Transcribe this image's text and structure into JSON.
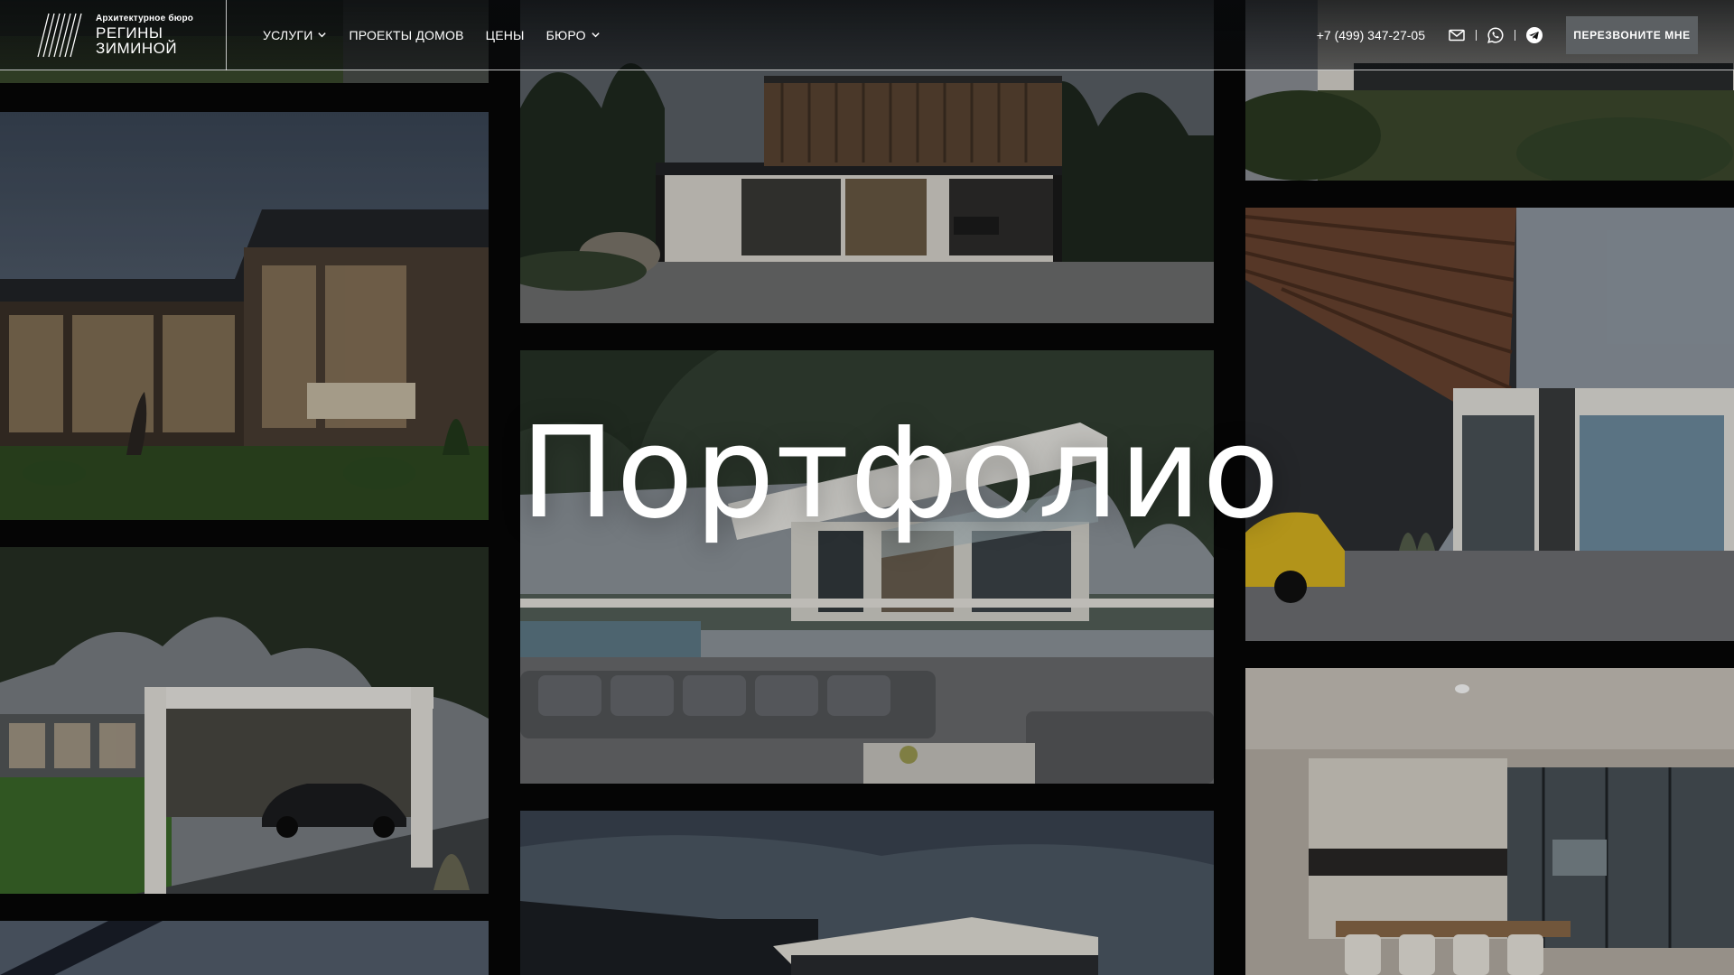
{
  "header": {
    "logo": {
      "tagline": "Архитектурное бюро",
      "line1": "РЕГИНЫ",
      "line2": "ЗИМИНОЙ"
    },
    "nav": [
      {
        "label": "УСЛУГИ",
        "has_dropdown": true
      },
      {
        "label": "ПРОЕКТЫ ДОМОВ",
        "has_dropdown": false
      },
      {
        "label": "ЦЕНЫ",
        "has_dropdown": false
      },
      {
        "label": "БЮРО",
        "has_dropdown": true
      }
    ],
    "phone": "+7 (499) 347-27-05",
    "icons": [
      "mail-icon",
      "whatsapp-icon",
      "telegram-icon"
    ],
    "callback_label": "ПЕРЕЗВОНИТЕ МНЕ"
  },
  "hero": {
    "title": "Портфолио"
  },
  "colors": {
    "background": "#050505",
    "button": "#5c6063",
    "text": "#ffffff"
  }
}
